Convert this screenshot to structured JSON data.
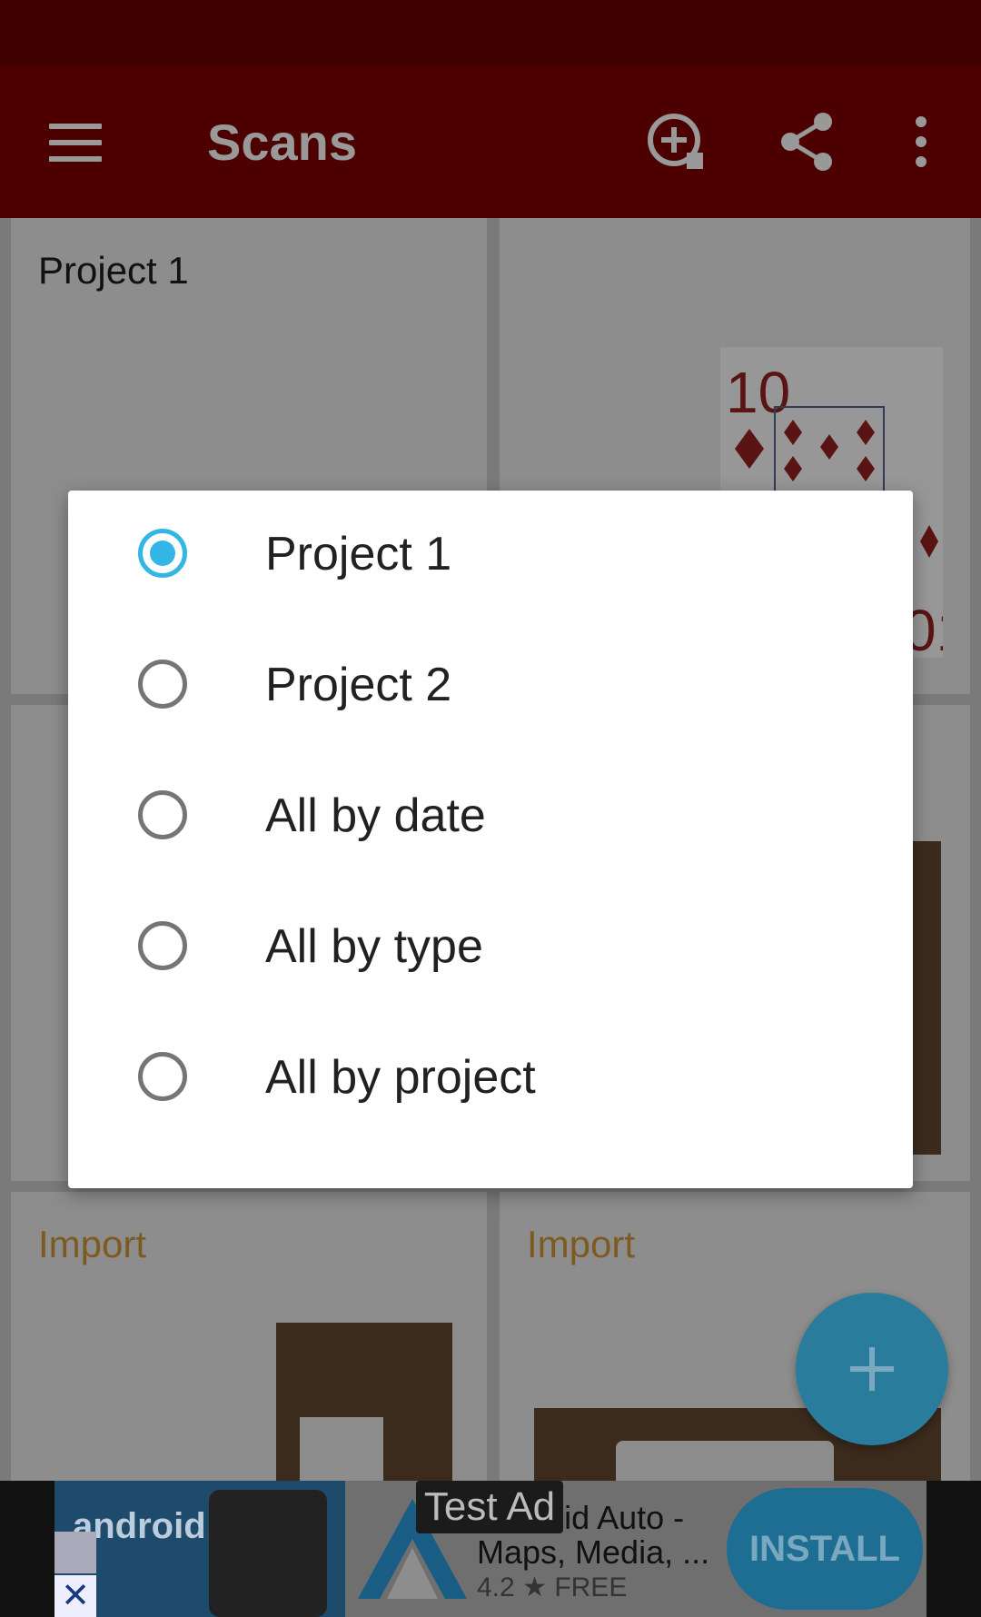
{
  "app_bar": {
    "title": "Scans",
    "menu_icon": "hamburger-menu-icon",
    "actions": [
      "add-scan-icon",
      "share-icon",
      "more-vert-icon"
    ]
  },
  "grid": {
    "cards": [
      {
        "label": "Project 1"
      },
      {
        "label": ""
      },
      {
        "label": ""
      },
      {
        "label": ""
      },
      {
        "label": "Import"
      },
      {
        "label": "Import"
      }
    ]
  },
  "dialog": {
    "options": [
      {
        "label": "Project 1",
        "selected": true
      },
      {
        "label": "Project 2",
        "selected": false
      },
      {
        "label": "All by date",
        "selected": false
      },
      {
        "label": "All by type",
        "selected": false
      },
      {
        "label": "All by project",
        "selected": false
      }
    ]
  },
  "fab": {
    "icon": "plus-icon"
  },
  "ad": {
    "badge": "Test Ad",
    "title_line1": "Android Auto -",
    "title_line2": "Maps, Media, ...",
    "rating": "4.2",
    "price": "FREE",
    "install_label": "INSTALL",
    "banner_text": "android auto"
  },
  "colors": {
    "app_bar": "#b00000",
    "accent": "#33b5e5",
    "import_label": "#e8a040"
  }
}
